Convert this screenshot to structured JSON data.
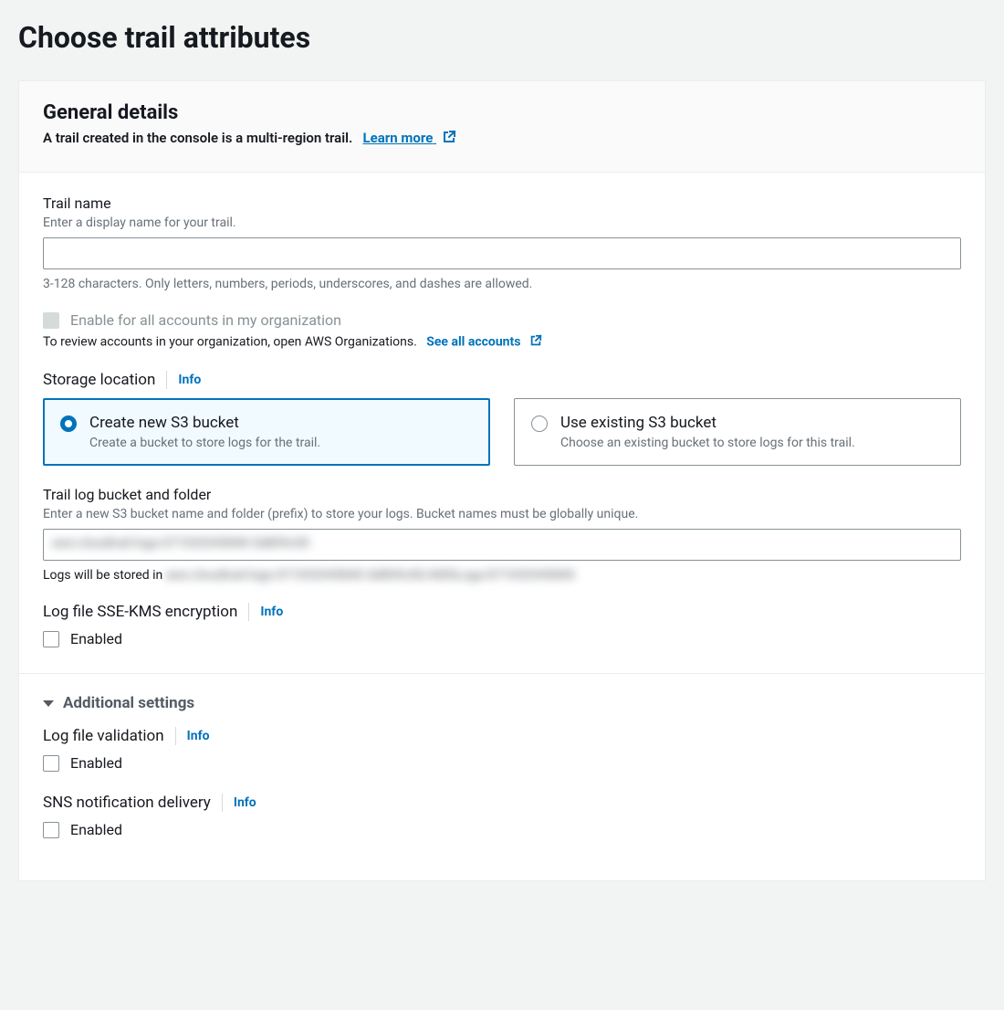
{
  "page": {
    "title": "Choose trail attributes"
  },
  "general": {
    "heading": "General details",
    "subtext": "A trail created in the console is a multi-region trail.",
    "learn_more": "Learn more"
  },
  "trail_name": {
    "label": "Trail name",
    "hint": "Enter a display name for your trail.",
    "value": "",
    "constraint": "3-128 characters. Only letters, numbers, periods, underscores, and dashes are allowed."
  },
  "org": {
    "checkbox_label": "Enable for all accounts in my organization",
    "checkbox_disabled": true,
    "hint_prefix": "To review accounts in your organization, open AWS Organizations.",
    "see_all": "See all accounts"
  },
  "storage": {
    "label": "Storage location",
    "info": "Info",
    "options": {
      "create": {
        "title": "Create new S3 bucket",
        "desc": "Create a bucket to store logs for the trail.",
        "selected": true
      },
      "existing": {
        "title": "Use existing S3 bucket",
        "desc": "Choose an existing bucket to store logs for this trail.",
        "selected": false
      }
    }
  },
  "bucket": {
    "label": "Trail log bucket and folder",
    "hint": "Enter a new S3 bucket name and folder (prefix) to store your logs. Bucket names must be globally unique.",
    "value_blurred": "aws-cloudtrail-logs-071033345840-3d809c00",
    "stored_in_prefix": "Logs will be stored in ",
    "stored_in_blurred": "aws-cloudtrail-logs-071033345840-3d809c00/AWSLogs/071033345840"
  },
  "kms": {
    "label": "Log file SSE-KMS encryption",
    "info": "Info",
    "enabled_label": "Enabled",
    "enabled": false
  },
  "additional": {
    "heading": "Additional settings",
    "validation": {
      "label": "Log file validation",
      "info": "Info",
      "enabled_label": "Enabled",
      "enabled": false
    },
    "sns": {
      "label": "SNS notification delivery",
      "info": "Info",
      "enabled_label": "Enabled",
      "enabled": false
    }
  }
}
